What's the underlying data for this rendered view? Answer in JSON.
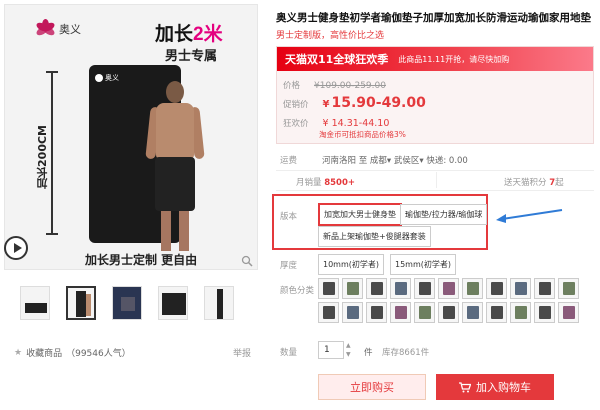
{
  "product_image": {
    "brand": "奥义",
    "headline_prefix": "加长",
    "headline_highlight": "2米",
    "subheadline": "男士专属",
    "length_label": "加长200CM",
    "caption": "加长男士定制 更自由",
    "mat_brand": "奥义"
  },
  "thumbnails": [
    {
      "id": 1
    },
    {
      "id": 2,
      "active": true
    },
    {
      "id": 3
    },
    {
      "id": 4
    },
    {
      "id": 5
    }
  ],
  "favorites": {
    "icon": "star-icon",
    "label": "收藏商品",
    "count": "（99546人气）"
  },
  "report": "举报",
  "product": {
    "title": "奥义男士健身垫初学者瑜伽垫子加厚加宽加长防滑运动瑜伽家用地垫",
    "subtitle": "男士定制版，高性价比之选"
  },
  "promo_banner": {
    "main": "天猫双11全球狂欢季",
    "sub": "此商品11.11开抢，请尽快加购"
  },
  "prices": {
    "original_label": "价格",
    "original": "¥109.00-259.00",
    "promo_label": "促销价",
    "promo_currency": "¥",
    "promo": "15.90-49.00",
    "overseas_label": "狂欢价",
    "overseas": "¥ 14.31-44.10",
    "overseas_note": "淘金币可抵扣商品价格3%"
  },
  "shipping": {
    "label": "运费",
    "text": "河南洛阳 至 成都▾ 武侯区▾ 快递: 0.00"
  },
  "sales": {
    "monthly_label": "月销量",
    "monthly": "8500+",
    "points_label": "送天猫积分",
    "points": "7",
    "points_unit": "起"
  },
  "variant": {
    "label": "版本",
    "options": [
      "加宽加大男士健身垫",
      "瑜伽垫/拉力器/瑜伽球",
      "新品上架瑜伽垫+俊腿器套装"
    ],
    "selected": 0
  },
  "thickness": {
    "label": "厚度",
    "options": [
      "10mm(初学者)",
      "15mm(初学者)"
    ]
  },
  "colors": {
    "label": "颜色分类",
    "count": 22
  },
  "quantity": {
    "label": "数量",
    "value": "1",
    "unit": "件",
    "stock": "库存8661件"
  },
  "actions": {
    "buy": "立即购买",
    "cart": "加入购物车",
    "cart_icon": "cart-icon"
  },
  "accent_color": "#e4393c",
  "banner_color": "#e60012"
}
